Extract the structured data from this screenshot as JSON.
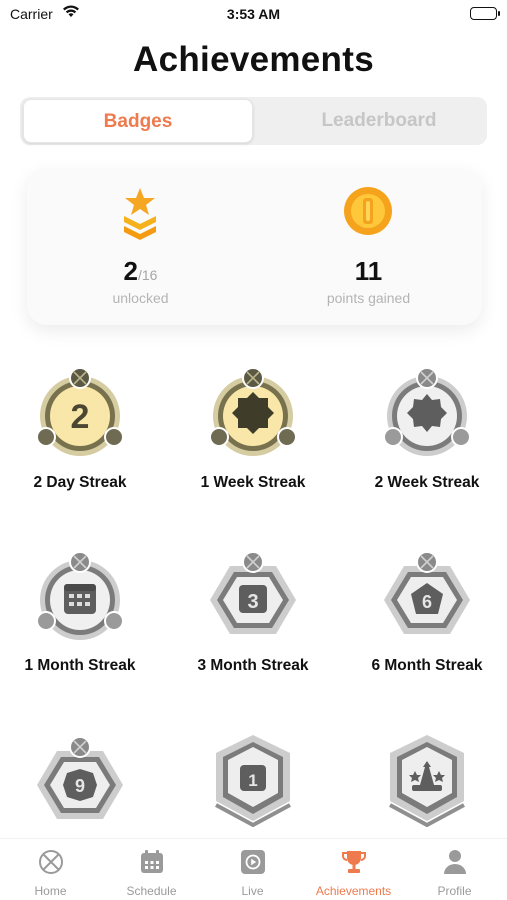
{
  "status_bar": {
    "carrier": "Carrier",
    "time": "3:53 AM"
  },
  "header": {
    "title": "Achievements"
  },
  "segments": {
    "badges_label": "Badges",
    "leaderboard_label": "Leaderboard",
    "selected": "Badges"
  },
  "stats": {
    "unlocked": {
      "value": "2",
      "total": "/16",
      "label": "unlocked",
      "icon": "star-stack-icon"
    },
    "points": {
      "value": "11",
      "label": "points gained",
      "icon": "gold-coin-icon"
    }
  },
  "badges": [
    {
      "label": "2 Day Streak",
      "state": "unlocked",
      "glyph": "2"
    },
    {
      "label": "1 Week Streak",
      "state": "unlocked",
      "glyph": ""
    },
    {
      "label": "2 Week Streak",
      "state": "locked",
      "glyph": ""
    },
    {
      "label": "1 Month Streak",
      "state": "locked",
      "glyph": ""
    },
    {
      "label": "3 Month Streak",
      "state": "locked",
      "glyph": "3"
    },
    {
      "label": "6 Month Streak",
      "state": "locked",
      "glyph": "6"
    },
    {
      "label": "",
      "state": "locked",
      "glyph": "9"
    },
    {
      "label": "",
      "state": "locked",
      "glyph": "1"
    },
    {
      "label": "",
      "state": "locked",
      "glyph": ""
    }
  ],
  "tabbar": {
    "items": [
      {
        "label": "Home",
        "icon": "home-icon",
        "active": false
      },
      {
        "label": "Schedule",
        "icon": "calendar-icon",
        "active": false
      },
      {
        "label": "Live",
        "icon": "play-icon",
        "active": false
      },
      {
        "label": "Achievements",
        "icon": "trophy-icon",
        "active": true
      },
      {
        "label": "Profile",
        "icon": "person-icon",
        "active": false
      }
    ]
  },
  "colors": {
    "accent": "#ee7a4e",
    "gold": "#f5b21d",
    "silver": "#8f8f8f"
  }
}
